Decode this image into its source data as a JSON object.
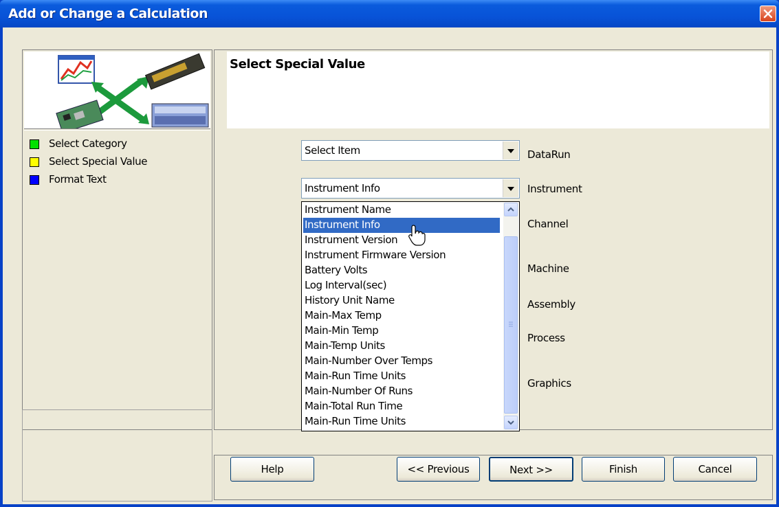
{
  "window": {
    "title": "Add or Change a Calculation"
  },
  "steps": [
    {
      "label": "Select Category",
      "color": "#00e000"
    },
    {
      "label": "Select Special Value",
      "color": "#ffff00"
    },
    {
      "label": "Format Text",
      "color": "#0000ff"
    }
  ],
  "header": {
    "title": "Select Special Value"
  },
  "combos": {
    "datarun": {
      "value": "Select Item",
      "label": "DataRun"
    },
    "instrument": {
      "value": "Instrument Info",
      "label": "Instrument"
    }
  },
  "side_labels": {
    "channel": "Channel",
    "machine": "Machine",
    "assembly": "Assembly",
    "process": "Process",
    "graphics": "Graphics"
  },
  "dropdown_items": [
    "Instrument Name",
    "Instrument Info",
    "Instrument Version",
    "Instrument Firmware Version",
    "Battery Volts",
    "Log Interval(sec)",
    "History Unit Name",
    "Main-Max Temp",
    "Main-Min Temp",
    "Main-Temp Units",
    "Main-Number Over Temps",
    "Main-Run Time Units",
    "Main-Number Of Runs",
    "Main-Total Run Time",
    "Main-Run Time Units"
  ],
  "dropdown_selected": "Instrument Info",
  "buttons": {
    "help": "Help",
    "previous": "<< Previous",
    "next": "Next >>",
    "finish": "Finish",
    "cancel": "Cancel"
  }
}
